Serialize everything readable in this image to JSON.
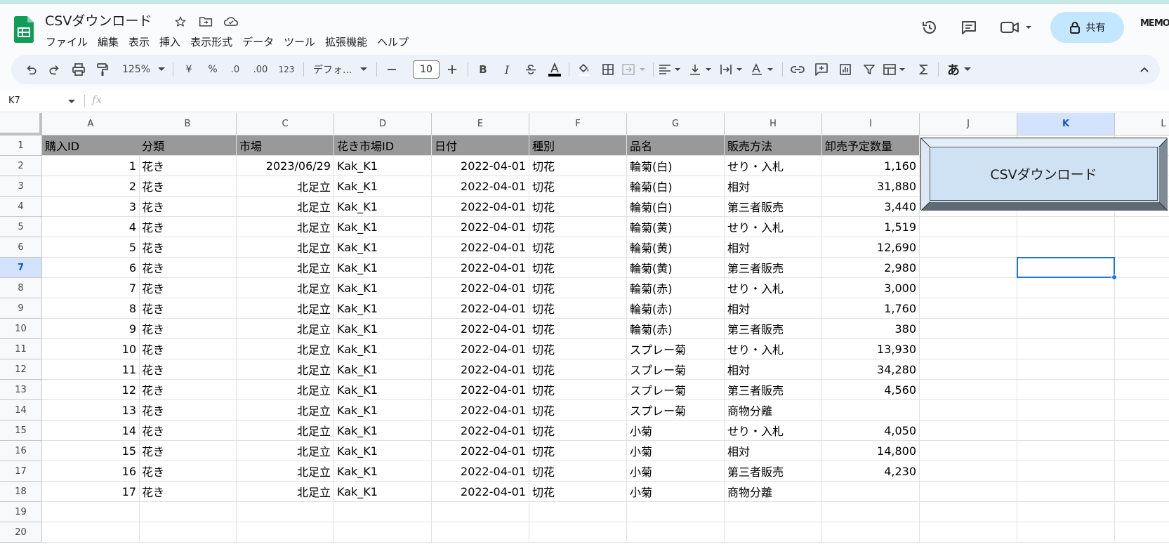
{
  "doc": {
    "title": "CSVダウンロード",
    "menu": [
      "ファイル",
      "編集",
      "表示",
      "挿入",
      "表示形式",
      "データ",
      "ツール",
      "拡張機能",
      "ヘルプ"
    ],
    "share_label": "共有",
    "memo_label": "MEMO"
  },
  "toolbar": {
    "zoom": "125%",
    "currency": "¥",
    "percent": "%",
    "dec_dec": ".0",
    "dec_inc": ".00",
    "number_format": "123",
    "font": "デフォ...",
    "font_size": "10",
    "bold": "B",
    "italic": "I",
    "ime": "あ"
  },
  "formula_bar": {
    "name_box": "K7",
    "fx": "fx"
  },
  "columns": [
    "A",
    "B",
    "C",
    "D",
    "E",
    "F",
    "G",
    "H",
    "I",
    "J",
    "K",
    "L"
  ],
  "selected_column": "K",
  "selected_row": "7",
  "rows": [
    "1",
    "2",
    "3",
    "4",
    "5",
    "6",
    "7",
    "8",
    "9",
    "10",
    "11",
    "12",
    "13",
    "14",
    "15",
    "16",
    "17",
    "18",
    "19",
    "20"
  ],
  "sheet": {
    "header": [
      "購入ID",
      "分類",
      "市場",
      "花き市場ID",
      "日付",
      "種別",
      "品名",
      "販売方法",
      "卸売予定数量"
    ],
    "data": [
      [
        "1",
        "花き",
        "2023/06/29",
        "Kak_K1",
        "2022-04-01",
        "切花",
        "輪菊(白)",
        "せり・入札",
        "1,160"
      ],
      [
        "2",
        "花き",
        "北足立",
        "Kak_K1",
        "2022-04-01",
        "切花",
        "輪菊(白)",
        "相対",
        "31,880"
      ],
      [
        "3",
        "花き",
        "北足立",
        "Kak_K1",
        "2022-04-01",
        "切花",
        "輪菊(白)",
        "第三者販売",
        "3,440"
      ],
      [
        "4",
        "花き",
        "北足立",
        "Kak_K1",
        "2022-04-01",
        "切花",
        "輪菊(黄)",
        "せり・入札",
        "1,519"
      ],
      [
        "5",
        "花き",
        "北足立",
        "Kak_K1",
        "2022-04-01",
        "切花",
        "輪菊(黄)",
        "相対",
        "12,690"
      ],
      [
        "6",
        "花き",
        "北足立",
        "Kak_K1",
        "2022-04-01",
        "切花",
        "輪菊(黄)",
        "第三者販売",
        "2,980"
      ],
      [
        "7",
        "花き",
        "北足立",
        "Kak_K1",
        "2022-04-01",
        "切花",
        "輪菊(赤)",
        "せり・入札",
        "3,000"
      ],
      [
        "8",
        "花き",
        "北足立",
        "Kak_K1",
        "2022-04-01",
        "切花",
        "輪菊(赤)",
        "相対",
        "1,760"
      ],
      [
        "9",
        "花き",
        "北足立",
        "Kak_K1",
        "2022-04-01",
        "切花",
        "輪菊(赤)",
        "第三者販売",
        "380"
      ],
      [
        "10",
        "花き",
        "北足立",
        "Kak_K1",
        "2022-04-01",
        "切花",
        "スプレー菊",
        "せり・入札",
        "13,930"
      ],
      [
        "11",
        "花き",
        "北足立",
        "Kak_K1",
        "2022-04-01",
        "切花",
        "スプレー菊",
        "相対",
        "34,280"
      ],
      [
        "12",
        "花き",
        "北足立",
        "Kak_K1",
        "2022-04-01",
        "切花",
        "スプレー菊",
        "第三者販売",
        "4,560"
      ],
      [
        "13",
        "花き",
        "北足立",
        "Kak_K1",
        "2022-04-01",
        "切花",
        "スプレー菊",
        "商物分離",
        ""
      ],
      [
        "14",
        "花き",
        "北足立",
        "Kak_K1",
        "2022-04-01",
        "切花",
        "小菊",
        "せり・入札",
        "4,050"
      ],
      [
        "15",
        "花き",
        "北足立",
        "Kak_K1",
        "2022-04-01",
        "切花",
        "小菊",
        "相対",
        "14,800"
      ],
      [
        "16",
        "花き",
        "北足立",
        "Kak_K1",
        "2022-04-01",
        "切花",
        "小菊",
        "第三者販売",
        "4,230"
      ],
      [
        "17",
        "花き",
        "北足立",
        "Kak_K1",
        "2022-04-01",
        "切花",
        "小菊",
        "商物分離",
        ""
      ]
    ]
  },
  "csv_button_label": "CSVダウンロード"
}
